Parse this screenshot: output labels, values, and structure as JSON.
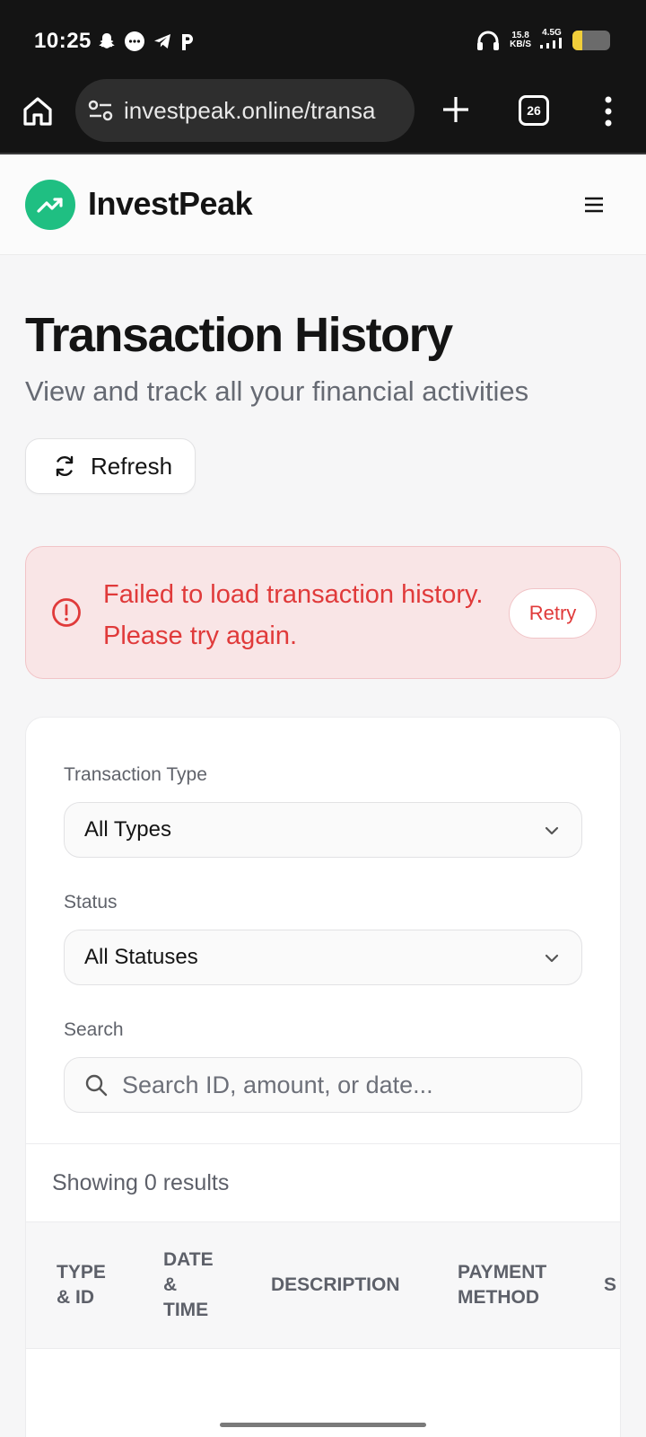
{
  "status_bar": {
    "time": "10:25",
    "net_speed_value": "15.8",
    "net_speed_unit": "KB/S",
    "network": "4.5G",
    "battery_level": 0.25,
    "battery_color": "#f2cf3a"
  },
  "browser": {
    "url": "investpeak.online/transa",
    "tab_count": "26"
  },
  "app": {
    "brand": "InvestPeak",
    "brand_color": "#1fbf82"
  },
  "page": {
    "title": "Transaction History",
    "subtitle": "View and track all your financial activities",
    "refresh_label": "Refresh"
  },
  "alert": {
    "message_line1": "Failed to load transaction history.",
    "message_line2": "Please try again.",
    "retry_label": "Retry",
    "color": "#e03a3a"
  },
  "filters": {
    "type_label": "Transaction Type",
    "type_value": "All Types",
    "status_label": "Status",
    "status_value": "All Statuses",
    "search_label": "Search",
    "search_placeholder": "Search ID, amount, or date..."
  },
  "results": {
    "summary": "Showing 0 results"
  },
  "table": {
    "columns": [
      {
        "line1": "TYPE",
        "line2": "& ID",
        "line3": ""
      },
      {
        "line1": "DATE",
        "line2": "&",
        "line3": "TIME"
      },
      {
        "line1": "DESCRIPTION",
        "line2": "",
        "line3": ""
      },
      {
        "line1": "PAYMENT",
        "line2": "METHOD",
        "line3": ""
      },
      {
        "line1": "S",
        "line2": "",
        "line3": ""
      }
    ]
  }
}
